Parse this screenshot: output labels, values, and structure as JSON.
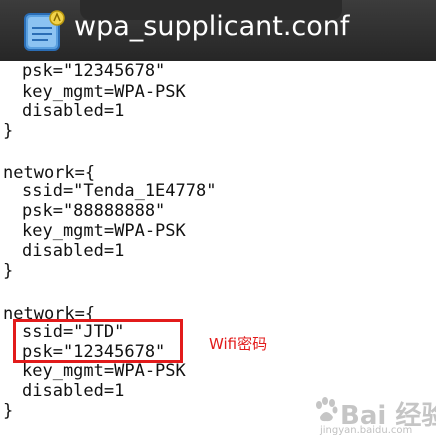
{
  "header": {
    "title": "wpa_supplicant.conf",
    "icon": "text-editor-icon"
  },
  "lines": [
    "psk=\"12345678\"",
    "key_mgmt=WPA-PSK",
    "disabled=1",
    "}",
    "",
    "network={",
    "ssid=\"Tenda_1E4778\"",
    "psk=\"88888888\"",
    "key_mgmt=WPA-PSK",
    "disabled=1",
    "}",
    "",
    "network={",
    "ssid=\"JTD\"",
    "psk=\"12345678\"",
    "key_mgmt=WPA-PSK",
    "disabled=1",
    "}"
  ],
  "annotation": {
    "label": "Wifi密码",
    "color": "#e21b1b"
  },
  "watermark": {
    "text": "Bai 经验",
    "subtext": "jingyan.baidu.com"
  }
}
